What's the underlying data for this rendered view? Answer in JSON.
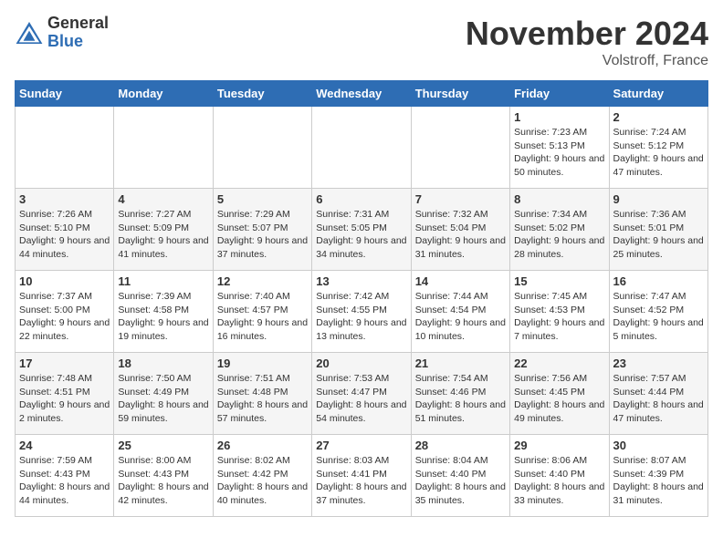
{
  "logo": {
    "general": "General",
    "blue": "Blue"
  },
  "header": {
    "month_title": "November 2024",
    "location": "Volstroff, France"
  },
  "weekdays": [
    "Sunday",
    "Monday",
    "Tuesday",
    "Wednesday",
    "Thursday",
    "Friday",
    "Saturday"
  ],
  "weeks": [
    [
      {
        "day": "",
        "info": ""
      },
      {
        "day": "",
        "info": ""
      },
      {
        "day": "",
        "info": ""
      },
      {
        "day": "",
        "info": ""
      },
      {
        "day": "",
        "info": ""
      },
      {
        "day": "1",
        "info": "Sunrise: 7:23 AM\nSunset: 5:13 PM\nDaylight: 9 hours and 50 minutes."
      },
      {
        "day": "2",
        "info": "Sunrise: 7:24 AM\nSunset: 5:12 PM\nDaylight: 9 hours and 47 minutes."
      }
    ],
    [
      {
        "day": "3",
        "info": "Sunrise: 7:26 AM\nSunset: 5:10 PM\nDaylight: 9 hours and 44 minutes."
      },
      {
        "day": "4",
        "info": "Sunrise: 7:27 AM\nSunset: 5:09 PM\nDaylight: 9 hours and 41 minutes."
      },
      {
        "day": "5",
        "info": "Sunrise: 7:29 AM\nSunset: 5:07 PM\nDaylight: 9 hours and 37 minutes."
      },
      {
        "day": "6",
        "info": "Sunrise: 7:31 AM\nSunset: 5:05 PM\nDaylight: 9 hours and 34 minutes."
      },
      {
        "day": "7",
        "info": "Sunrise: 7:32 AM\nSunset: 5:04 PM\nDaylight: 9 hours and 31 minutes."
      },
      {
        "day": "8",
        "info": "Sunrise: 7:34 AM\nSunset: 5:02 PM\nDaylight: 9 hours and 28 minutes."
      },
      {
        "day": "9",
        "info": "Sunrise: 7:36 AM\nSunset: 5:01 PM\nDaylight: 9 hours and 25 minutes."
      }
    ],
    [
      {
        "day": "10",
        "info": "Sunrise: 7:37 AM\nSunset: 5:00 PM\nDaylight: 9 hours and 22 minutes."
      },
      {
        "day": "11",
        "info": "Sunrise: 7:39 AM\nSunset: 4:58 PM\nDaylight: 9 hours and 19 minutes."
      },
      {
        "day": "12",
        "info": "Sunrise: 7:40 AM\nSunset: 4:57 PM\nDaylight: 9 hours and 16 minutes."
      },
      {
        "day": "13",
        "info": "Sunrise: 7:42 AM\nSunset: 4:55 PM\nDaylight: 9 hours and 13 minutes."
      },
      {
        "day": "14",
        "info": "Sunrise: 7:44 AM\nSunset: 4:54 PM\nDaylight: 9 hours and 10 minutes."
      },
      {
        "day": "15",
        "info": "Sunrise: 7:45 AM\nSunset: 4:53 PM\nDaylight: 9 hours and 7 minutes."
      },
      {
        "day": "16",
        "info": "Sunrise: 7:47 AM\nSunset: 4:52 PM\nDaylight: 9 hours and 5 minutes."
      }
    ],
    [
      {
        "day": "17",
        "info": "Sunrise: 7:48 AM\nSunset: 4:51 PM\nDaylight: 9 hours and 2 minutes."
      },
      {
        "day": "18",
        "info": "Sunrise: 7:50 AM\nSunset: 4:49 PM\nDaylight: 8 hours and 59 minutes."
      },
      {
        "day": "19",
        "info": "Sunrise: 7:51 AM\nSunset: 4:48 PM\nDaylight: 8 hours and 57 minutes."
      },
      {
        "day": "20",
        "info": "Sunrise: 7:53 AM\nSunset: 4:47 PM\nDaylight: 8 hours and 54 minutes."
      },
      {
        "day": "21",
        "info": "Sunrise: 7:54 AM\nSunset: 4:46 PM\nDaylight: 8 hours and 51 minutes."
      },
      {
        "day": "22",
        "info": "Sunrise: 7:56 AM\nSunset: 4:45 PM\nDaylight: 8 hours and 49 minutes."
      },
      {
        "day": "23",
        "info": "Sunrise: 7:57 AM\nSunset: 4:44 PM\nDaylight: 8 hours and 47 minutes."
      }
    ],
    [
      {
        "day": "24",
        "info": "Sunrise: 7:59 AM\nSunset: 4:43 PM\nDaylight: 8 hours and 44 minutes."
      },
      {
        "day": "25",
        "info": "Sunrise: 8:00 AM\nSunset: 4:43 PM\nDaylight: 8 hours and 42 minutes."
      },
      {
        "day": "26",
        "info": "Sunrise: 8:02 AM\nSunset: 4:42 PM\nDaylight: 8 hours and 40 minutes."
      },
      {
        "day": "27",
        "info": "Sunrise: 8:03 AM\nSunset: 4:41 PM\nDaylight: 8 hours and 37 minutes."
      },
      {
        "day": "28",
        "info": "Sunrise: 8:04 AM\nSunset: 4:40 PM\nDaylight: 8 hours and 35 minutes."
      },
      {
        "day": "29",
        "info": "Sunrise: 8:06 AM\nSunset: 4:40 PM\nDaylight: 8 hours and 33 minutes."
      },
      {
        "day": "30",
        "info": "Sunrise: 8:07 AM\nSunset: 4:39 PM\nDaylight: 8 hours and 31 minutes."
      }
    ]
  ]
}
